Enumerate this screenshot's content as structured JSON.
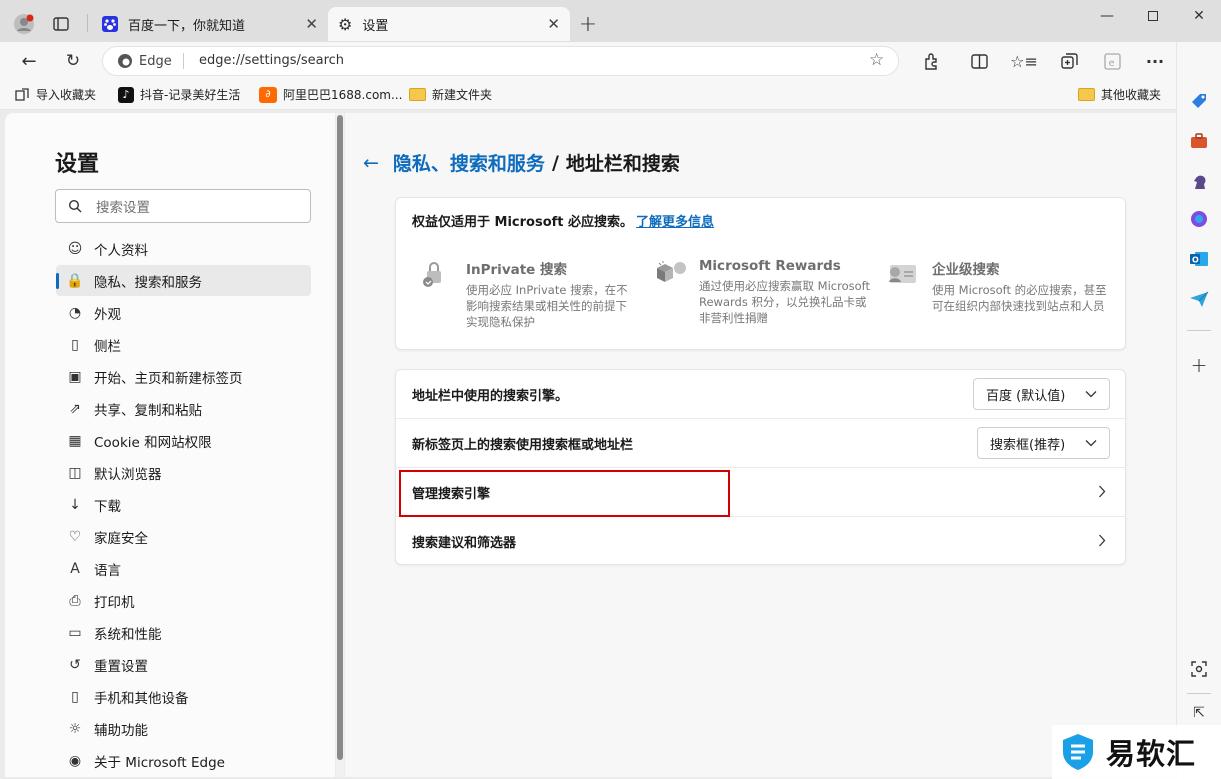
{
  "tabs": [
    {
      "label": "百度一下，你就知道",
      "active": false
    },
    {
      "label": "设置",
      "active": true
    }
  ],
  "address": {
    "site_label": "Edge",
    "url": "edge://settings/search"
  },
  "bookmarks": {
    "items": [
      "导入收藏夹",
      "抖音-记录美好生活",
      "阿里巴巴1688.com...",
      "新建文件夹"
    ],
    "other": "其他收藏夹"
  },
  "settings": {
    "title": "设置",
    "search_placeholder": "搜索设置",
    "nav": [
      {
        "label": "个人资料",
        "icon": "profile-icon"
      },
      {
        "label": "隐私、搜索和服务",
        "icon": "lock-icon",
        "selected": true
      },
      {
        "label": "外观",
        "icon": "palette-icon"
      },
      {
        "label": "侧栏",
        "icon": "sidebar-icon"
      },
      {
        "label": "开始、主页和新建标签页",
        "icon": "home-icon"
      },
      {
        "label": "共享、复制和粘贴",
        "icon": "share-icon"
      },
      {
        "label": "Cookie 和网站权限",
        "icon": "cookie-icon"
      },
      {
        "label": "默认浏览器",
        "icon": "browser-icon"
      },
      {
        "label": "下载",
        "icon": "download-icon"
      },
      {
        "label": "家庭安全",
        "icon": "family-icon"
      },
      {
        "label": "语言",
        "icon": "language-icon"
      },
      {
        "label": "打印机",
        "icon": "printer-icon"
      },
      {
        "label": "系统和性能",
        "icon": "system-icon"
      },
      {
        "label": "重置设置",
        "icon": "reset-icon"
      },
      {
        "label": "手机和其他设备",
        "icon": "phone-icon"
      },
      {
        "label": "辅助功能",
        "icon": "accessibility-icon"
      },
      {
        "label": "关于 Microsoft Edge",
        "icon": "edge-logo-icon"
      }
    ]
  },
  "breadcrumb": {
    "parent": "隐私、搜索和服务",
    "separator": "/",
    "current": "地址栏和搜索"
  },
  "benefits": {
    "header": "权益仅适用于 Microsoft 必应搜索。",
    "link": "了解更多信息",
    "features": [
      {
        "title": "InPrivate 搜索",
        "desc": "使用必应 InPrivate 搜索，在不影响搜索结果或相关性的前提下实现隐私保护"
      },
      {
        "title": "Microsoft Rewards",
        "desc": "通过使用必应搜索赢取 Microsoft Rewards 积分，以兑换礼品卡或非营利性捐赠"
      },
      {
        "title": "企业级搜索",
        "desc": "使用 Microsoft 的必应搜索，甚至可在组织内部快速找到站点和人员"
      }
    ]
  },
  "rows": [
    {
      "label": "地址栏中使用的搜索引擎。",
      "value": "百度 (默认值)"
    },
    {
      "label": "新标签页上的搜索使用搜索框或地址栏",
      "value": "搜索框(推荐)"
    },
    {
      "label": "管理搜索引擎"
    },
    {
      "label": "搜索建议和筛选器"
    }
  ],
  "watermark": "易软汇",
  "colors": {
    "accent": "#0f6cbd",
    "highlight": "#d40000"
  }
}
